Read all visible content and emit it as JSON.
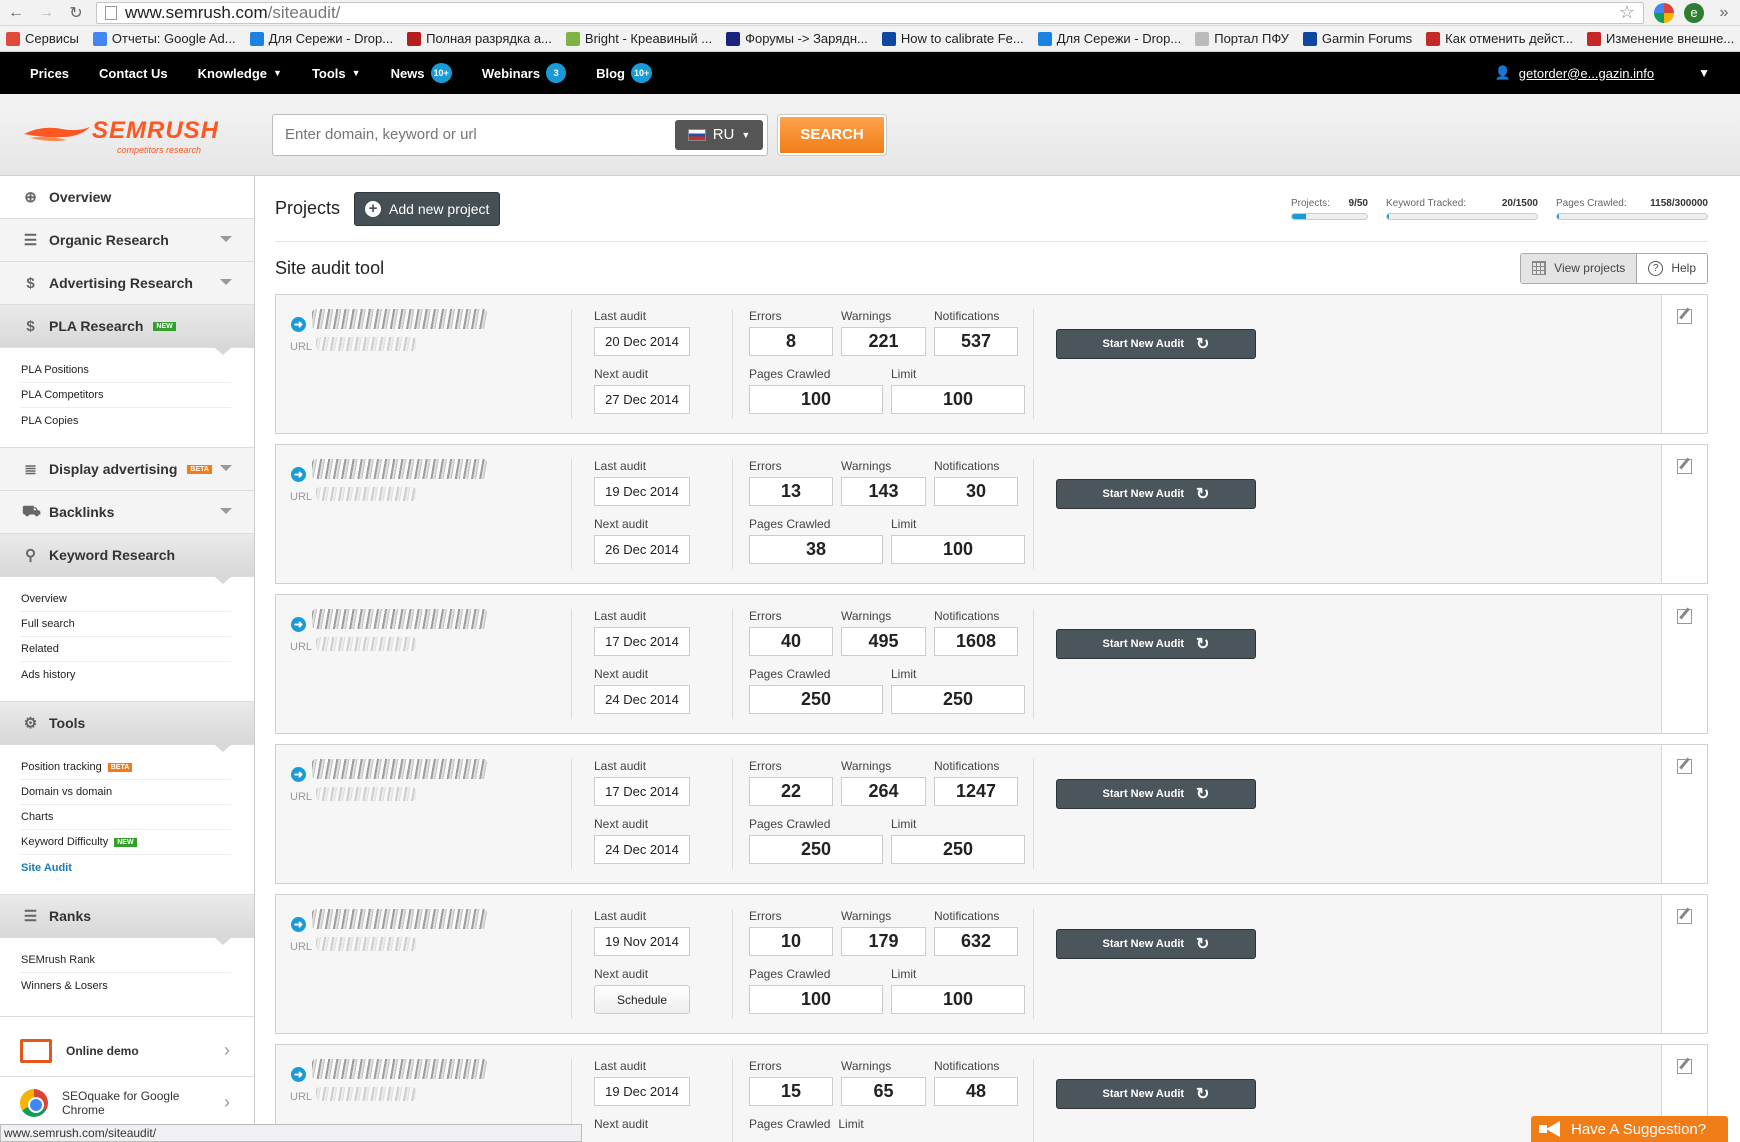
{
  "browser": {
    "url_domain": "www.semrush.com",
    "url_path": "/siteaudit/",
    "status_url": "www.semrush.com/siteaudit/"
  },
  "bookmarks": [
    {
      "label": "Сервисы",
      "icon": "apps-grid-icon",
      "color": "#e04a39"
    },
    {
      "label": "Отчеты: Google Ad...",
      "icon": "google-icon",
      "color": "#4285f4"
    },
    {
      "label": "Для Сережи - Drop...",
      "icon": "dropbox-icon",
      "color": "#1a82e2"
    },
    {
      "label": "Полная разрядка а...",
      "icon": "battery-site-icon",
      "color": "#b71c1c"
    },
    {
      "label": "Bright - Креавиный ...",
      "icon": "leaf-icon",
      "color": "#7cb342"
    },
    {
      "label": "Форумы -> Зарядн...",
      "icon": "h-icon",
      "color": "#1a237e"
    },
    {
      "label": "How to calibrate Fe...",
      "icon": "triangle-icon",
      "color": "#0d47a1"
    },
    {
      "label": "Для Сережи - Drop...",
      "icon": "dropbox-icon",
      "color": "#1a82e2"
    },
    {
      "label": "Портал ПФУ",
      "icon": "page-icon",
      "color": "#bbbbbb"
    },
    {
      "label": "Garmin Forums",
      "icon": "triangle-icon",
      "color": "#0d47a1"
    },
    {
      "label": "Как отменить дейст...",
      "icon": "excl-icon",
      "color": "#c62828"
    },
    {
      "label": "Изменение внешне...",
      "icon": "excl-icon",
      "color": "#c62828"
    }
  ],
  "topnav": {
    "items": [
      {
        "label": "Prices",
        "badge": "",
        "dropdown": false
      },
      {
        "label": "Contact Us",
        "badge": "",
        "dropdown": false
      },
      {
        "label": "Knowledge",
        "badge": "",
        "dropdown": true
      },
      {
        "label": "Tools",
        "badge": "",
        "dropdown": true
      },
      {
        "label": "News",
        "badge": "10+",
        "dropdown": false
      },
      {
        "label": "Webinars",
        "badge": "3",
        "dropdown": false
      },
      {
        "label": "Blog",
        "badge": "10+",
        "dropdown": false
      }
    ],
    "user_email": "getorder@e...gazin.info"
  },
  "header": {
    "logo_name": "SEMRUSH",
    "logo_tagline": "competitors research",
    "search_placeholder": "Enter domain, keyword or url",
    "database": "RU",
    "search_button": "SEARCH"
  },
  "sidebar": {
    "overview": "Overview",
    "organic": "Organic Research",
    "advertising": "Advertising Research",
    "pla": "PLA Research",
    "pla_items": [
      "PLA Positions",
      "PLA Competitors",
      "PLA Copies"
    ],
    "display": "Display advertising",
    "backlinks": "Backlinks",
    "keyword": "Keyword Research",
    "keyword_items": [
      "Overview",
      "Full search",
      "Related",
      "Ads history"
    ],
    "tools": "Tools",
    "tools_items": [
      "Position tracking",
      "Domain vs domain",
      "Charts",
      "Keyword Difficulty",
      "Site Audit"
    ],
    "ranks": "Ranks",
    "ranks_items": [
      "SEMrush Rank",
      "Winners & Losers"
    ],
    "online_demo": "Online demo",
    "seoquake": "SEOquake for Google Chrome",
    "tag_new": "NEW",
    "tag_beta": "BETA"
  },
  "projects": {
    "title": "Projects",
    "add_button": "Add new project",
    "limits": [
      {
        "label": "Projects:",
        "value": "9/50",
        "fill": 0.18
      },
      {
        "label": "Keyword Tracked:",
        "value": "20/1500",
        "fill": 0.013
      },
      {
        "label": "Pages Crawled:",
        "value": "1158/300000",
        "fill": 0.004
      }
    ]
  },
  "site_audit": {
    "title": "Site audit tool",
    "view_projects": "View projects",
    "help": "Help",
    "labels": {
      "last_audit": "Last audit",
      "next_audit": "Next audit",
      "errors": "Errors",
      "warnings": "Warnings",
      "notifications": "Notifications",
      "pages_crawled": "Pages Crawled",
      "limit": "Limit",
      "url": "URL",
      "start": "Start New Audit"
    },
    "cards": [
      {
        "last": "20 Dec 2014",
        "next": "27 Dec 2014",
        "next_is_button": false,
        "errors": "8",
        "warnings": "221",
        "notifications": "537",
        "crawled": "100",
        "limit": "100"
      },
      {
        "last": "19 Dec 2014",
        "next": "26 Dec 2014",
        "next_is_button": false,
        "errors": "13",
        "warnings": "143",
        "notifications": "30",
        "crawled": "38",
        "limit": "100"
      },
      {
        "last": "17 Dec 2014",
        "next": "24 Dec 2014",
        "next_is_button": false,
        "errors": "40",
        "warnings": "495",
        "notifications": "1608",
        "crawled": "250",
        "limit": "250"
      },
      {
        "last": "17 Dec 2014",
        "next": "24 Dec 2014",
        "next_is_button": false,
        "errors": "22",
        "warnings": "264",
        "notifications": "1247",
        "crawled": "250",
        "limit": "250"
      },
      {
        "last": "19 Nov 2014",
        "next": "Schedule",
        "next_is_button": true,
        "errors": "10",
        "warnings": "179",
        "notifications": "632",
        "crawled": "100",
        "limit": "100"
      },
      {
        "last": "19 Dec 2014",
        "next": "",
        "next_is_button": false,
        "errors": "15",
        "warnings": "65",
        "notifications": "48",
        "crawled": "",
        "limit": ""
      }
    ]
  },
  "suggestion": "Have A Suggestion?",
  "colors": {
    "brand": "#ff5722",
    "accent": "#1a9bd7",
    "search_button": "#f07d18",
    "dark_button": "#4b565c"
  }
}
